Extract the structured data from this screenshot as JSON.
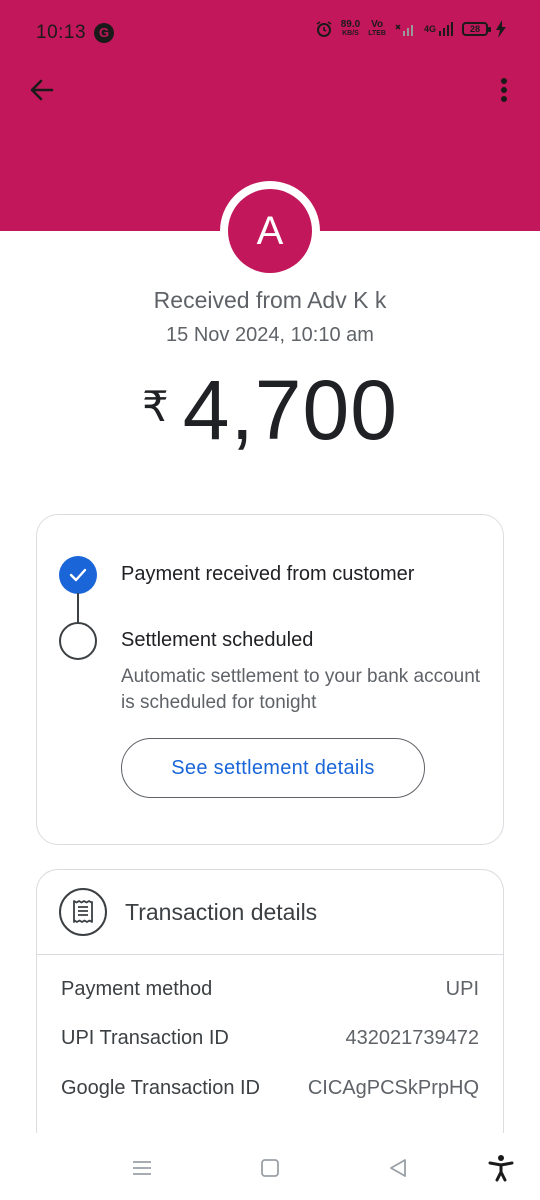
{
  "colors": {
    "brand": "#c2185b",
    "accent_blue": "#1a66d9"
  },
  "status_bar": {
    "time": "10:13",
    "g_icon": "G",
    "speed_value": "89.0",
    "speed_unit": "KB/S",
    "volte_top": "Vo",
    "volte_bottom": "LTEB",
    "network": "4G",
    "battery": "28",
    "icons": [
      "alarm-icon",
      "signal-icon",
      "charging-icon"
    ]
  },
  "toolbar": {
    "back_icon": "arrow-back-icon",
    "more_icon": "more-vert-icon"
  },
  "payer": {
    "avatar_initial": "A",
    "received_text": "Received from Adv K k",
    "datetime": "15 Nov 2024, 10:10 am",
    "currency_symbol": "₹",
    "amount": "4,700"
  },
  "status": {
    "step1_label": "Payment received from customer",
    "step2_label": "Settlement scheduled",
    "step2_description": "Automatic settlement to your bank account is scheduled for tonight",
    "settlement_button": "See settlement details"
  },
  "transaction": {
    "title": "Transaction details",
    "rows": [
      {
        "label": "Payment method",
        "value": "UPI"
      },
      {
        "label": "UPI Transaction ID",
        "value": "432021739472"
      },
      {
        "label": "Google Transaction ID",
        "value": "CICAgPCSkPrpHQ"
      }
    ]
  },
  "nav_bar": {
    "icons": [
      "menu-icon",
      "home-icon",
      "back-icon",
      "accessibility-icon"
    ]
  }
}
